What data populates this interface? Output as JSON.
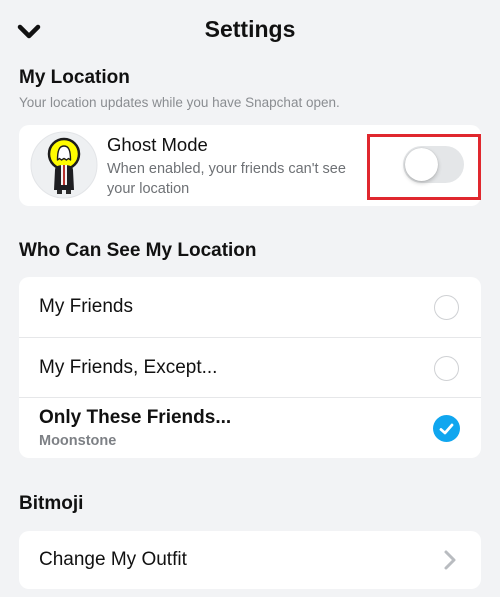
{
  "header": {
    "title": "Settings",
    "back_icon": "chevron-down-icon"
  },
  "my_location": {
    "title": "My Location",
    "subtitle": "Your location updates while you have Snapchat open.",
    "ghost_mode": {
      "title": "Ghost Mode",
      "description": "When enabled, your friends can't see your location",
      "enabled": false,
      "avatar_icon": "bitmoji-ghost-avatar-icon"
    }
  },
  "who_can_see": {
    "title": "Who Can See My Location",
    "options": [
      {
        "label": "My Friends",
        "selected": false
      },
      {
        "label": "My Friends, Except...",
        "selected": false
      },
      {
        "label": "Only These Friends...",
        "sublabel": "Moonstone",
        "selected": true
      }
    ]
  },
  "bitmoji": {
    "title": "Bitmoji",
    "items": [
      {
        "label": "Change My Outfit",
        "icon": "chevron-right-icon"
      }
    ]
  },
  "colors": {
    "background": "#f2f3f5",
    "accent_blue": "#10a6ef",
    "highlight_red": "#e0282e",
    "ghost_yellow": "#fffc00",
    "toggle_off": "#e4e6e8"
  }
}
